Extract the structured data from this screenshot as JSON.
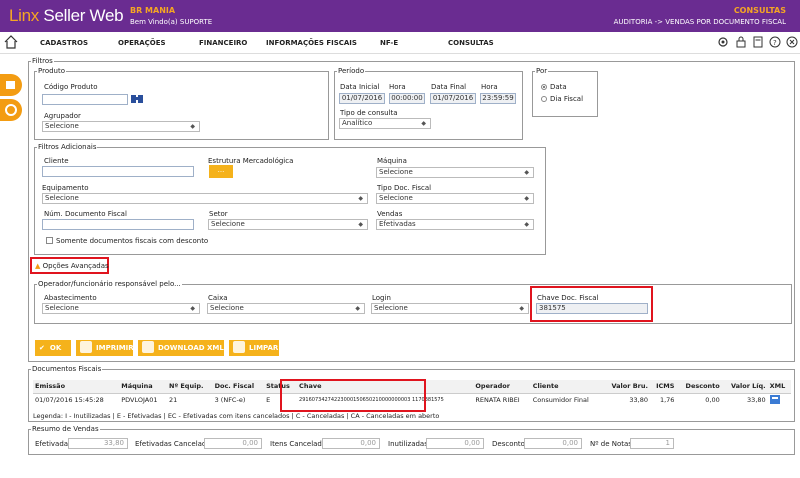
{
  "app": {
    "logo_a": "Linx",
    "logo_b": " Seller Web",
    "store": "BR MANIA",
    "welcome": "Bem Vindo(a) SUPORTE",
    "section": "CONSULTAS",
    "breadcrumb": "AUDITORIA -> VENDAS POR DOCUMENTO FISCAL"
  },
  "nav": [
    "CADASTROS",
    "OPERAÇÕES",
    "FINANCEIRO",
    "INFORMAÇÕES FISCAIS",
    "NF-E",
    "CONSULTAS"
  ],
  "colors": {
    "header": "#6a2c91",
    "accent": "#f5a623",
    "button": "#f5b21b",
    "highlight": "#e0141e"
  },
  "filters": {
    "legend": "Filtros",
    "produto": {
      "legend": "Produto",
      "codigo_label": "Código Produto",
      "codigo_value": "",
      "agrupador_label": "Agrupador",
      "agrupador_value": "Selecione"
    },
    "periodo": {
      "legend": "Período",
      "data_inicial_label": "Data Inicial",
      "data_inicial": "01/07/2016",
      "hora1_label": "Hora",
      "hora1": "00:00:00",
      "data_final_label": "Data Final",
      "data_final": "01/07/2016",
      "hora2_label": "Hora",
      "hora2": "23:59:59",
      "tipo_label": "Tipo de consulta",
      "tipo_value": "Analítico"
    },
    "por": {
      "legend": "Por",
      "opt1": "Data",
      "opt2": "Dia Fiscal",
      "selected": "Data"
    },
    "adicionais": {
      "legend": "Filtros Adicionais",
      "cliente_label": "Cliente",
      "cliente_value": "",
      "estrutura_label": "Estrutura Mercadológica",
      "estrutura_btn": "...",
      "maquina_label": "Máquina",
      "maquina_value": "Selecione",
      "equip_label": "Equipamento",
      "equip_value": "Selecione",
      "tipo_doc_label": "Tipo Doc. Fiscal",
      "tipo_doc_value": "Selecione",
      "num_doc_label": "Núm. Documento Fiscal",
      "num_doc_value": "",
      "setor_label": "Setor",
      "setor_value": "Selecione",
      "vendas_label": "Vendas",
      "vendas_value": "Efetivadas",
      "somente_label": "Somente documentos fiscais com desconto"
    },
    "avancadas_label": "Opções Avançadas",
    "operador": {
      "legend": "Operador/funcionário responsável pelo...",
      "abast_label": "Abastecimento",
      "abast_value": "Selecione",
      "caixa_label": "Caixa",
      "caixa_value": "Selecione",
      "login_label": "Login",
      "login_value": "Selecione",
      "chave_label": "Chave Doc. Fiscal",
      "chave_value": "381575"
    }
  },
  "buttons": {
    "ok": "OK",
    "imprimir": "IMPRIMIR",
    "download": "DOWNLOAD XMLS",
    "limpar": "LIMPAR"
  },
  "docs": {
    "legend": "Documentos Fiscais",
    "columns": [
      "Emissão",
      "Máquina",
      "Nº Equip.",
      "Doc. Fiscal",
      "Status",
      "Chave",
      "Operador",
      "Cliente",
      "Valor Bru.",
      "ICMS",
      "Desconto",
      "Valor Líq.",
      "XML"
    ],
    "rows": [
      [
        "01/07/2016 15:45:28",
        "PDVLOJA01",
        "21",
        "3 (NFC-e)",
        "E",
        "29160734274223000150650210000000003 1170381575",
        "RENATA RIBEI",
        "Consumidor Final",
        "33,80",
        "1,76",
        "0,00",
        "33,80"
      ]
    ],
    "legenda": "Legenda: I - Inutilizadas | E - Efetivadas | EC - Efetivadas com itens cancelados | C - Canceladas | CA - Canceladas em aberto"
  },
  "resumo": {
    "legend": "Resumo de Vendas",
    "efetivadas_label": "Efetivadas",
    "efetivadas": "33,80",
    "efet_canc_label": "Efetivadas Canceladas",
    "efet_canc": "0,00",
    "itens_canc_label": "Itens Cancelados",
    "itens_canc": "0,00",
    "inutil_label": "Inutilizadas",
    "inutil": "0,00",
    "desc_label": "Descontos",
    "desc": "0,00",
    "notas_label": "Nº de Notas",
    "notas": "1"
  }
}
